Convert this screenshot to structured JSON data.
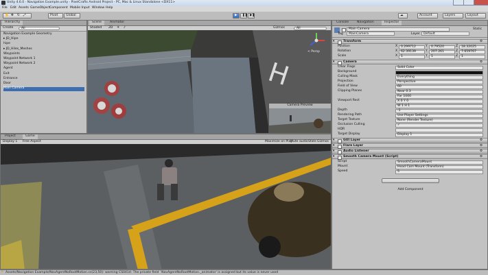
{
  "title": "Unity 4.6.0 - Navigation Example.unity - PixelCrafts Android Project - PC, Mac & Linux Standalone <DX11>",
  "menu": [
    "File",
    "Edit",
    "Assets",
    "GameObject",
    "Component",
    "Mobile Input",
    "Window",
    "Help"
  ],
  "toolbar": {
    "pivot": "Pivot",
    "global": "Global",
    "account": "Account",
    "layers": "Layers",
    "layout": "Layout"
  },
  "hierarchy": {
    "tab": "Hierarchy",
    "create": "Create",
    "search": "All",
    "items": [
      "Navigation Example Geometry",
      "▸ JD_Hipe",
      "  hipe",
      "▸ JD_Hiles_Meshes",
      "Waypoints",
      "  Waypoint Network 1",
      "  Waypoint Network 2",
      "Agent",
      "Exit",
      "Entrance",
      "Door",
      "Main Camera"
    ],
    "selected_index": 11
  },
  "scene": {
    "tabs": [
      "Scene",
      "Animator"
    ],
    "shaded": "Shaded",
    "mode2d": "2D",
    "gizmos": "Gizmos",
    "search": "All",
    "persp": "< Persp",
    "camera_preview": "Camera Preview"
  },
  "game": {
    "tabs": [
      "Project",
      "Game"
    ],
    "display": "Display 1",
    "aspect": "Free Aspect",
    "toggles": [
      "Maximize on Play",
      "Mute audio",
      "Stats",
      "Gizmos"
    ]
  },
  "inspector": {
    "tabs": [
      "Console",
      "Navigation",
      "Inspector"
    ],
    "object_name": "Main Camera",
    "static": "Static",
    "tag_label": "Tag",
    "tag": "MainCamera",
    "layer_label": "Layer",
    "layer": "Default",
    "transform": {
      "title": "Transform",
      "rows": [
        {
          "label": "Position",
          "x": "0.299712",
          "y": "0.79520",
          "z": "18.32025"
        },
        {
          "label": "Rotation",
          "x": "62.39139",
          "y": "207.261",
          "z": "7.659767"
        },
        {
          "label": "Scale",
          "x": "1",
          "y": "1",
          "z": "1"
        }
      ]
    },
    "camera": {
      "title": "Camera",
      "rows": [
        {
          "label": "Clear Flags",
          "value": "Solid Color"
        },
        {
          "label": "Background",
          "value": ""
        },
        {
          "label": "Culling Mask",
          "value": "Everything"
        },
        {
          "label": "Projection",
          "value": "Perspective"
        },
        {
          "label": "Field of View",
          "value": "60"
        },
        {
          "label": "Clipping Planes",
          "value": "Near  0.3"
        },
        {
          "label": "",
          "value": "Far  1000"
        },
        {
          "label": "Viewport Rect",
          "value": "X 0   Y 0"
        },
        {
          "label": "",
          "value": "W 1   H 1"
        },
        {
          "label": "Depth",
          "value": "-1"
        },
        {
          "label": "Rendering Path",
          "value": "Use Player Settings"
        },
        {
          "label": "Target Texture",
          "value": "None (Render Texture)"
        },
        {
          "label": "Occlusion Culling",
          "value": "✓"
        },
        {
          "label": "HDR",
          "value": ""
        },
        {
          "label": "Target Display",
          "value": "Display 1"
        }
      ]
    },
    "components": [
      "GUI Layer",
      "Flare Layer",
      "Audio Listener",
      "Smooth Camera Mount (Script)"
    ],
    "script_rows": [
      {
        "label": "Script",
        "value": "SmoothCameraMount"
      },
      {
        "label": "Mount",
        "value": "Head Cam Mount (Transform)"
      },
      {
        "label": "Speed",
        "value": "5"
      }
    ],
    "add_component": "Add Component"
  },
  "status": "Assets/Navigation Example/NavAgentNoRootMotion.cs(23,50): warning CS0414: The private field `NavAgentNoRootMotion._animator' is assigned but its value is never used",
  "colors": {
    "selection": "#3d6fb0",
    "warning": "#e0b000",
    "panel": "#c2c2c2"
  }
}
